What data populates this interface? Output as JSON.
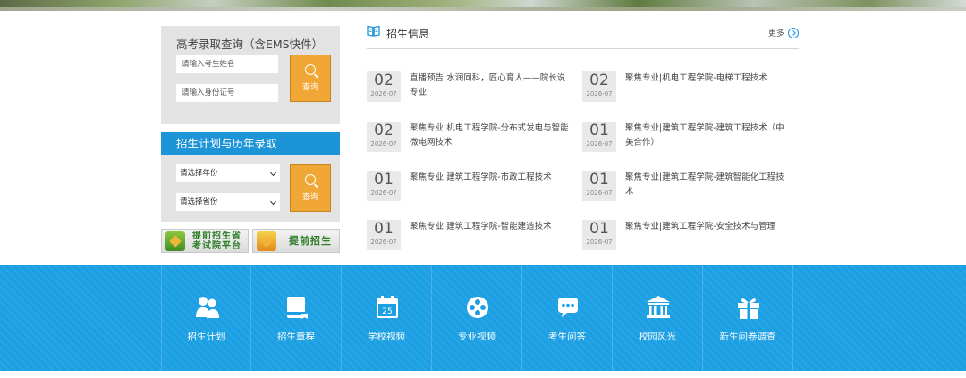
{
  "query": {
    "title": "高考录取查询（含EMS快件）",
    "name_placeholder": "请输入考生姓名",
    "id_placeholder": "请输入身份证号",
    "search_label": "查询"
  },
  "plan": {
    "title": "招生计划与历年录取",
    "year_select": "请选择年份",
    "province_select": "请选择省份",
    "search_label": "查询"
  },
  "banners": [
    {
      "label_line1": "提前招生省",
      "label_line2": "考试院平台"
    },
    {
      "label_line1": "提前招生",
      "label_line2": ""
    }
  ],
  "news": {
    "title": "招生信息",
    "more_label": "更多",
    "items": [
      {
        "day": "02",
        "ym": "2026-07",
        "text": "直播预告|水润同科，匠心育人——院长说专业"
      },
      {
        "day": "02",
        "ym": "2026-07",
        "text": "聚焦专业|机电工程学院-电梯工程技术"
      },
      {
        "day": "02",
        "ym": "2026-07",
        "text": "聚焦专业|机电工程学院-分布式发电与智能微电网技术"
      },
      {
        "day": "01",
        "ym": "2026-07",
        "text": "聚焦专业|建筑工程学院-建筑工程技术（中美合作）"
      },
      {
        "day": "01",
        "ym": "2026-07",
        "text": "聚焦专业|建筑工程学院-市政工程技术"
      },
      {
        "day": "01",
        "ym": "2026-07",
        "text": "聚焦专业|建筑工程学院-建筑智能化工程技术"
      },
      {
        "day": "01",
        "ym": "2026-07",
        "text": "聚焦专业|建筑工程学院-智能建造技术"
      },
      {
        "day": "01",
        "ym": "2026-07",
        "text": "聚焦专业|建筑工程学院-安全技术与管理"
      }
    ]
  },
  "quicklinks": [
    {
      "label": "招生计划",
      "icon": "people-icon"
    },
    {
      "label": "招生章程",
      "icon": "book-icon"
    },
    {
      "label": "学校视频",
      "icon": "calendar-icon"
    },
    {
      "label": "专业视频",
      "icon": "film-reel-icon"
    },
    {
      "label": "考生问答",
      "icon": "chat-bubble-icon"
    },
    {
      "label": "校园风光",
      "icon": "building-icon"
    },
    {
      "label": "新生问卷调查",
      "icon": "gift-icon"
    }
  ],
  "colors": {
    "accent_blue": "#1e94d8",
    "band_blue": "#1da0e3",
    "button_orange": "#f0a735"
  }
}
